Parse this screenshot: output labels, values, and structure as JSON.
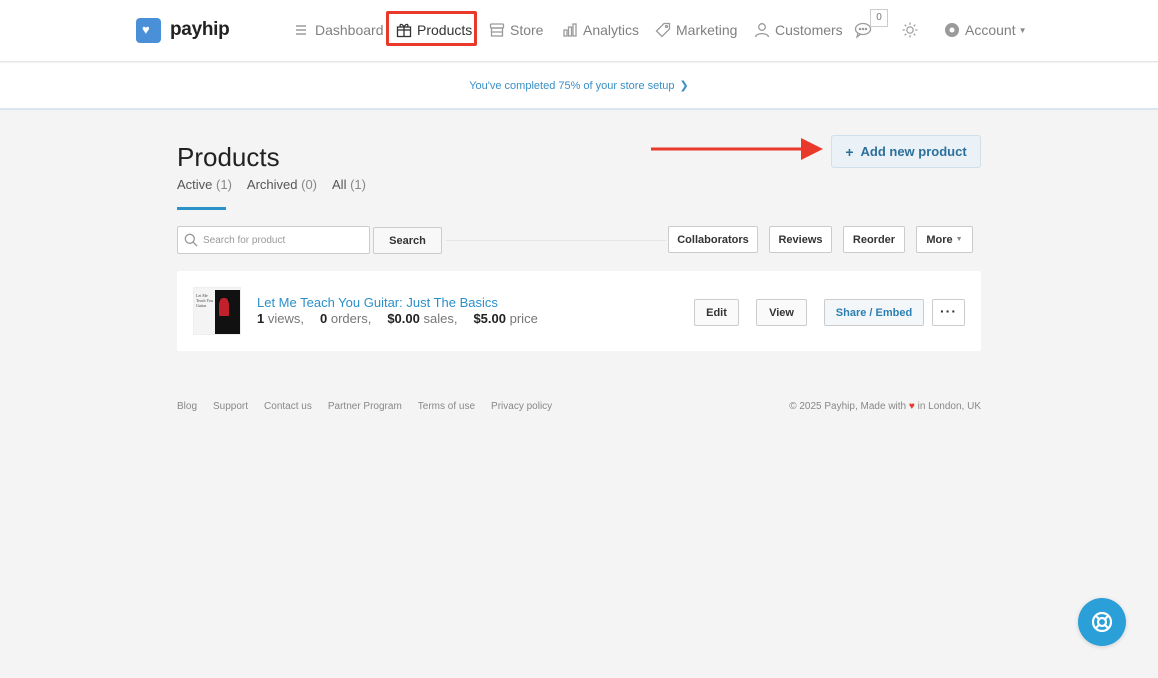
{
  "brand": {
    "name": "payhip",
    "color": "#4a90d9"
  },
  "nav": {
    "dashboard": "Dashboard",
    "products": "Products",
    "store": "Store",
    "analytics": "Analytics",
    "marketing": "Marketing",
    "customers": "Customers",
    "notification_count": "0",
    "account": "Account",
    "icons": [
      "menu-icon",
      "gift-box-icon",
      "storefront-icon",
      "analytics-icon",
      "tag-icon",
      "user-icon",
      "chat-icon",
      "sun-icon",
      "gear-icon",
      "chevron-down-icon"
    ]
  },
  "setup_banner": {
    "text": "You've completed 75% of your store setup",
    "progress_percent": 75
  },
  "page": {
    "title": "Products",
    "add_button": "Add new product",
    "tabs": [
      {
        "label": "Active",
        "count": "(1)"
      },
      {
        "label": "Archived",
        "count": "(0)"
      },
      {
        "label": "All",
        "count": "(1)"
      }
    ]
  },
  "toolbar": {
    "search_placeholder": "Search for product",
    "search_button": "Search",
    "collaborators": "Collaborators",
    "reviews": "Reviews",
    "reorder": "Reorder",
    "more": "More"
  },
  "products": [
    {
      "title": "Let Me Teach You Guitar: Just The Basics",
      "thumb_text": "Let Me Teach You Guitar",
      "views": "1",
      "views_label": "views,",
      "orders": "0",
      "orders_label": "orders,",
      "sales": "$0.00",
      "sales_label": "sales,",
      "price": "$5.00",
      "price_label": "price",
      "edit": "Edit",
      "view": "View",
      "share": "Share / Embed",
      "more": "···"
    }
  ],
  "footer": {
    "links": [
      "Blog",
      "Support",
      "Contact us",
      "Partner Program",
      "Terms of use",
      "Privacy policy"
    ],
    "copyright_prefix": "© 2025 Payhip, Made with",
    "copyright_suffix": "in London, UK"
  },
  "colors": {
    "accent": "#2b93c9",
    "highlight": "#e8392b",
    "help_button": "#2a9fd8"
  }
}
